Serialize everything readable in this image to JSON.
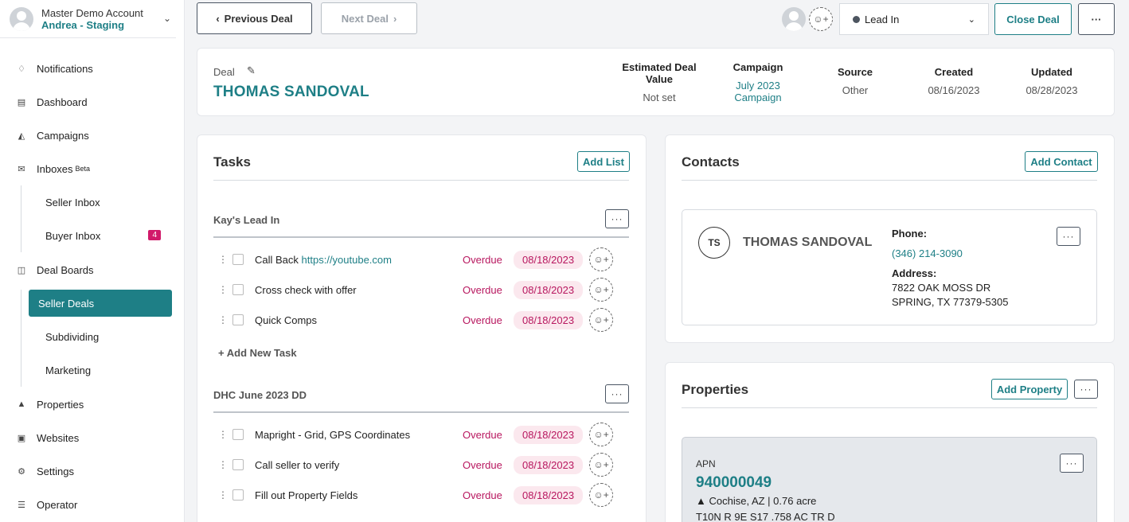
{
  "account": {
    "name": "Master Demo Account",
    "sub": "Andrea - Staging"
  },
  "nav": {
    "notifications": "Notifications",
    "dashboard": "Dashboard",
    "campaigns": "Campaigns",
    "inboxes": "Inboxes",
    "inboxes_tag": "Beta",
    "seller_inbox": "Seller Inbox",
    "buyer_inbox": "Buyer Inbox",
    "buyer_inbox_count": "4",
    "deal_boards": "Deal Boards",
    "seller_deals": "Seller Deals",
    "subdividing": "Subdividing",
    "marketing": "Marketing",
    "properties": "Properties",
    "websites": "Websites",
    "settings": "Settings",
    "operator": "Operator"
  },
  "toolbar": {
    "prev": "Previous Deal",
    "next": "Next Deal",
    "status": "Lead In",
    "close_deal": "Close Deal",
    "more": "···"
  },
  "deal": {
    "label": "Deal",
    "title": "THOMAS SANDOVAL",
    "meta": {
      "est_label": "Estimated Deal Value",
      "est_value": "Not set",
      "campaign_label": "Campaign",
      "campaign_value": "July 2023 Campaign",
      "source_label": "Source",
      "source_value": "Other",
      "created_label": "Created",
      "created_value": "08/16/2023",
      "updated_label": "Updated",
      "updated_value": "08/28/2023"
    }
  },
  "tasks": {
    "title": "Tasks",
    "add_list": "Add List",
    "add_new_task": "Add New Task",
    "lists": [
      {
        "name": "Kay's Lead In",
        "items": [
          {
            "text": "Call Back ",
            "link": "https://youtube.com",
            "status": "Overdue",
            "date": "08/18/2023"
          },
          {
            "text": "Cross check with offer",
            "status": "Overdue",
            "date": "08/18/2023"
          },
          {
            "text": "Quick Comps",
            "status": "Overdue",
            "date": "08/18/2023"
          }
        ]
      },
      {
        "name": "DHC June 2023 DD",
        "items": [
          {
            "text": "Mapright - Grid, GPS Coordinates",
            "status": "Overdue",
            "date": "08/18/2023"
          },
          {
            "text": "Call seller to verify",
            "status": "Overdue",
            "date": "08/18/2023"
          },
          {
            "text": "Fill out Property Fields",
            "status": "Overdue",
            "date": "08/18/2023"
          }
        ]
      }
    ]
  },
  "contacts": {
    "title": "Contacts",
    "add": "Add Contact",
    "contact": {
      "initials": "TS",
      "name": "THOMAS SANDOVAL",
      "phone_label": "Phone:",
      "phone": "(346) 214-3090",
      "address_label": "Address:",
      "address_line1": "7822 OAK MOSS DR",
      "address_line2": "SPRING, TX 77379-5305"
    }
  },
  "properties": {
    "title": "Properties",
    "add": "Add Property",
    "item": {
      "apn_label": "APN",
      "apn": "940000049",
      "location": "Cochise, AZ | 0.76 acre",
      "legal": "T10N R 9E S17 .758 AC TR D"
    }
  }
}
